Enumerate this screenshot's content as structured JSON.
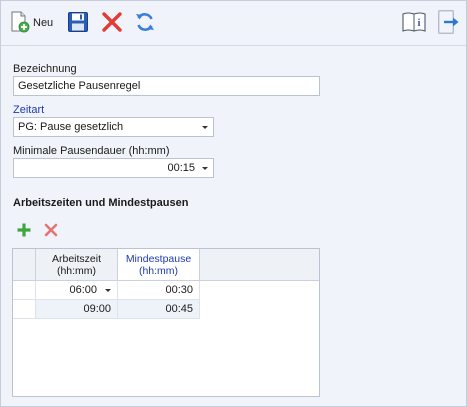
{
  "toolbar": {
    "new_label": "Neu",
    "icons": [
      "new-document-icon",
      "save-icon",
      "delete-icon",
      "refresh-icon",
      "help-book-icon",
      "exit-arrow-icon"
    ]
  },
  "form": {
    "bezeichnung_label": "Bezeichnung",
    "bezeichnung_value": "Gesetzliche Pausenregel",
    "zeitart_label": "Zeitart",
    "zeitart_value": "PG: Pause gesetzlich",
    "min_pause_label": "Minimale Pausendauer (hh:mm)",
    "min_pause_value": "00:15"
  },
  "section": {
    "title": "Arbeitszeiten und Mindestpausen"
  },
  "grid": {
    "columns": [
      {
        "line1": "Arbeitszeit",
        "line2": "(hh:mm)"
      },
      {
        "line1": "Mindestpause",
        "line2": "(hh:mm)"
      }
    ],
    "rows": [
      {
        "arbeitszeit": "06:00",
        "mindestpause": "00:30"
      },
      {
        "arbeitszeit": "09:00",
        "mindestpause": "00:45"
      }
    ]
  },
  "colors": {
    "accent_blue": "#1e3ab4",
    "delete_red": "#e53935",
    "add_green": "#3fa53f",
    "save_blue": "#2a5db8"
  }
}
